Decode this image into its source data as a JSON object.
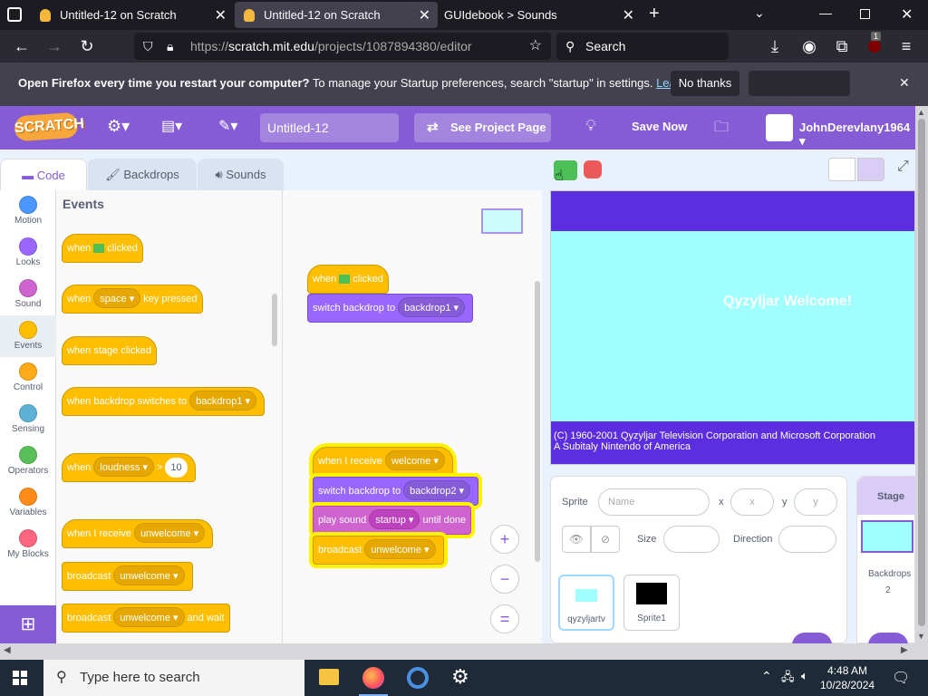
{
  "browser": {
    "tabs": [
      {
        "title": "Untitled-12 on Scratch",
        "active": false
      },
      {
        "title": "Untitled-12 on Scratch",
        "active": true
      },
      {
        "title": "GUIdebook > Sounds",
        "active": false
      }
    ],
    "url_prefix": "https://",
    "url_host": "scratch.mit.edu",
    "url_path": "/projects/1087894380/editor",
    "search_placeholder": "Search",
    "extension_badge": "1"
  },
  "notification": {
    "bold": "Open Firefox every time you restart your computer?",
    "text": " To manage your Startup preferences, search \"startup\" in settings. ",
    "link": "Learn more",
    "no_thanks": "No thanks"
  },
  "menubar": {
    "logo": "SCRATCH",
    "project_title": "Untitled-12",
    "see_project": "See Project Page",
    "save_now": "Save Now",
    "username": "JohnDerevlany1964"
  },
  "editor_tabs": {
    "code": "Code",
    "backdrops": "Backdrops",
    "sounds": "Sounds"
  },
  "categories": [
    {
      "label": "Motion",
      "color": "#4c97ff"
    },
    {
      "label": "Looks",
      "color": "#9966ff"
    },
    {
      "label": "Sound",
      "color": "#cf63cf"
    },
    {
      "label": "Events",
      "color": "#ffbf00"
    },
    {
      "label": "Control",
      "color": "#ffab19"
    },
    {
      "label": "Sensing",
      "color": "#5cb1d6"
    },
    {
      "label": "Operators",
      "color": "#59c059"
    },
    {
      "label": "Variables",
      "color": "#ff8c1a"
    },
    {
      "label": "My Blocks",
      "color": "#ff6680"
    }
  ],
  "palette": {
    "heading": "Events",
    "when": "when",
    "clicked": "clicked",
    "space": "space",
    "key_pressed": "key pressed",
    "when_stage_clicked": "when stage clicked",
    "when_backdrop_switches_to": "when backdrop switches to",
    "backdrop1": "backdrop1",
    "loudness": "loudness",
    "gt": ">",
    "ten": "10",
    "when_i_receive": "when I receive",
    "unwelcome": "unwelcome",
    "broadcast": "broadcast",
    "and_wait": "and wait"
  },
  "script1": {
    "when": "when",
    "clicked": "clicked",
    "switch_backdrop_to": "switch backdrop to",
    "backdrop1": "backdrop1"
  },
  "script2": {
    "when_i_receive": "when I receive",
    "welcome": "welcome",
    "switch_backdrop_to": "switch backdrop to",
    "backdrop2": "backdrop2",
    "play_sound": "play sound",
    "startup": "startup",
    "until_done": "until done",
    "broadcast": "broadcast",
    "unwelcome": "unwelcome"
  },
  "zoom": {
    "in": "+",
    "out": "−",
    "reset": "="
  },
  "stage": {
    "welcome_text": "Qyzyljar Welcome!",
    "copyright_line1": "(C) 1960-2001 Qyzyljar Television Corporation and Microsoft Corporation",
    "copyright_line2": "A Subitaly Nintendo of America"
  },
  "sprite_info": {
    "sprite_label": "Sprite",
    "name_placeholder": "Name",
    "x_label": "x",
    "x_placeholder": "x",
    "y_label": "y",
    "y_placeholder": "y",
    "size_label": "Size",
    "direction_label": "Direction",
    "sprites": [
      {
        "name": "qyzyljartv"
      },
      {
        "name": "Sprite1"
      }
    ]
  },
  "stage_pane": {
    "title": "Stage",
    "backdrops_label": "Backdrops",
    "backdrops_count": "2"
  },
  "taskbar": {
    "search_text": "Type here to search",
    "time": "4:48 AM",
    "date": "10/28/2024"
  }
}
